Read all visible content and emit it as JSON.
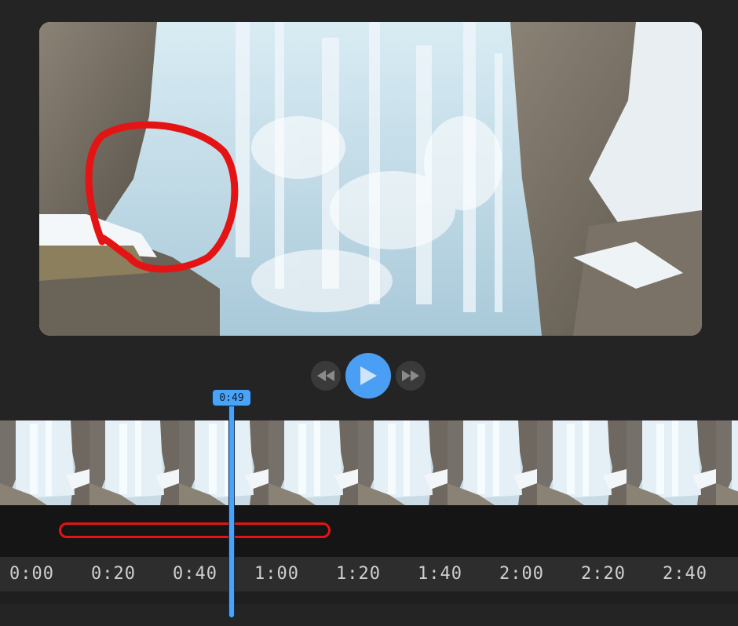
{
  "preview": {
    "description_icon": "frozen-waterfall-video-frame"
  },
  "controls": {
    "rewind_icon": "rewind-icon",
    "play_icon": "play-icon",
    "forward_icon": "fast-forward-icon"
  },
  "playhead": {
    "time": "0:49"
  },
  "ruler": {
    "ticks": [
      "0:00",
      "0:20",
      "0:40",
      "1:00",
      "1:20",
      "1:40",
      "2:00",
      "2:20",
      "2:40"
    ]
  },
  "colors": {
    "accent": "#4a9ff5",
    "annotation": "#e41414",
    "background": "#242424"
  }
}
